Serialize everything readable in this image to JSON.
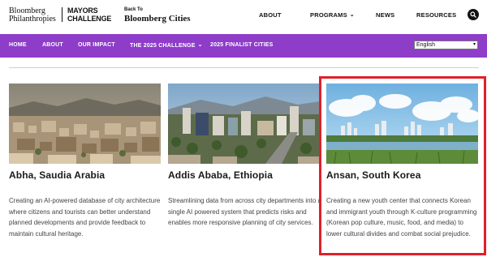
{
  "header": {
    "logo_line1": "Bloomberg",
    "logo_line2": "Philanthropies",
    "challenge_line1": "MAYORS",
    "challenge_line2": "CHALLENGE",
    "back_small": "Back To",
    "back_big": "Bloomberg Cities",
    "nav": [
      {
        "label": "ABOUT"
      },
      {
        "label": "PROGRAMS",
        "icon": "chevron-down-icon"
      },
      {
        "label": "NEWS"
      },
      {
        "label": "RESOURCES"
      }
    ],
    "search_icon": "search-icon"
  },
  "subnav": {
    "items": [
      {
        "label": "HOME"
      },
      {
        "label": "ABOUT"
      },
      {
        "label": "OUR IMPACT"
      },
      {
        "label": "THE 2025 CHALLENGE",
        "icon": "chevron-down-icon"
      },
      {
        "label": "2025 FINALIST CITIES"
      }
    ],
    "language": "English",
    "bg_color": "#8e3dc9"
  },
  "cards": [
    {
      "title": "Abha, Saudia Arabia",
      "description": "Creating an AI-powered database of city architecture where citizens and tourists can better understand planned developments and provide feedback to maintain cultural heritage."
    },
    {
      "title": "Addis Ababa, Ethiopia",
      "description": "Streamlining data from across city departments into a single AI powered system that predicts risks and enables more responsive planning of city services."
    },
    {
      "title": "Ansan, South Korea",
      "description": "Creating a new youth center that connects Korean and immigrant youth through K-culture programming (Korean pop culture, music, food, and media) to lower cultural divides and combat social prejudice."
    }
  ],
  "highlight_color": "#e0202a"
}
